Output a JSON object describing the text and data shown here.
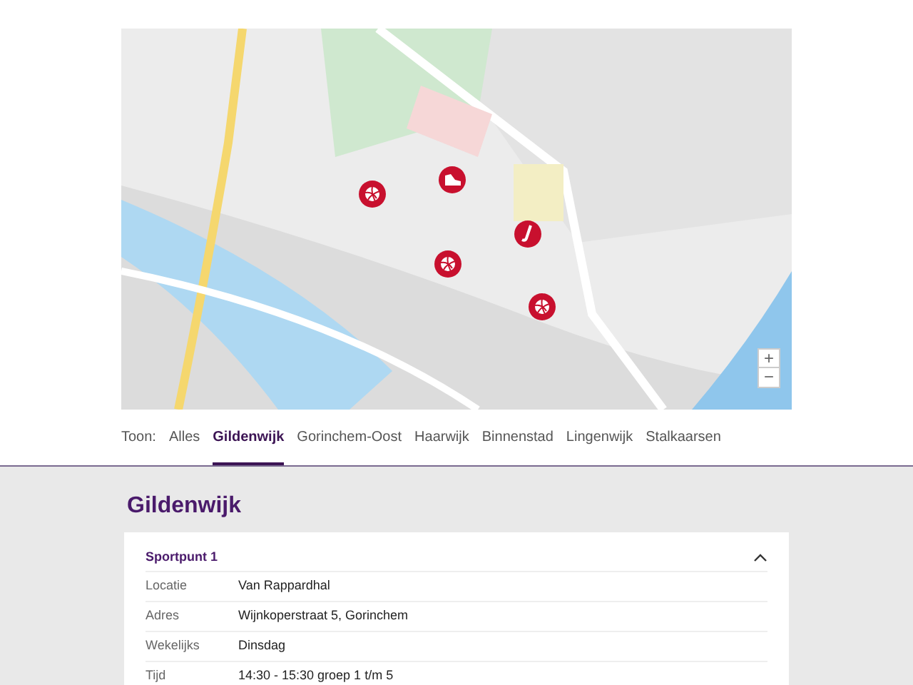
{
  "map": {
    "markers": [
      {
        "kind": "ball"
      },
      {
        "kind": "shoe"
      },
      {
        "kind": "stick"
      },
      {
        "kind": "ball"
      },
      {
        "kind": "ball"
      }
    ],
    "zoom_in": "+",
    "zoom_out": "−"
  },
  "filter": {
    "label": "Toon:",
    "tabs": [
      {
        "label": "Alles",
        "selected": false
      },
      {
        "label": "Gildenwijk",
        "selected": true
      },
      {
        "label": "Gorinchem-Oost",
        "selected": false
      },
      {
        "label": "Haarwijk",
        "selected": false
      },
      {
        "label": "Binnenstad",
        "selected": false
      },
      {
        "label": "Lingenwijk",
        "selected": false
      },
      {
        "label": "Stalkaarsen",
        "selected": false
      }
    ]
  },
  "section": {
    "title": "Gildenwijk",
    "cards": [
      {
        "title": "Sportpunt 1",
        "expanded": true,
        "rows": [
          {
            "label": "Locatie",
            "value": "Van Rappardhal"
          },
          {
            "label": "Adres",
            "value": "Wijnkoperstraat 5, Gorinchem"
          },
          {
            "label": "Wekelijks",
            "value": "Dinsdag"
          },
          {
            "label": "Tijd",
            "value": "14:30 - 15:30 groep 1 t/m 5"
          }
        ]
      }
    ]
  }
}
